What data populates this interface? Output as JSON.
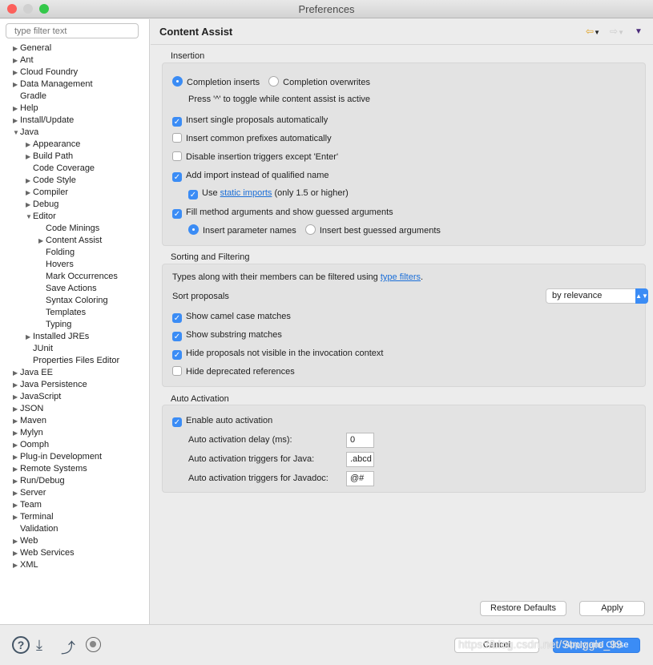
{
  "window": {
    "title": "Preferences"
  },
  "sidebar": {
    "filter_placeholder": "type filter text",
    "items": [
      {
        "label": "General",
        "level": 0,
        "arrow": "right"
      },
      {
        "label": "Ant",
        "level": 0,
        "arrow": "right"
      },
      {
        "label": "Cloud Foundry",
        "level": 0,
        "arrow": "right"
      },
      {
        "label": "Data Management",
        "level": 0,
        "arrow": "right"
      },
      {
        "label": "Gradle",
        "level": 0,
        "arrow": ""
      },
      {
        "label": "Help",
        "level": 0,
        "arrow": "right"
      },
      {
        "label": "Install/Update",
        "level": 0,
        "arrow": "right"
      },
      {
        "label": "Java",
        "level": 0,
        "arrow": "down"
      },
      {
        "label": "Appearance",
        "level": 1,
        "arrow": "right"
      },
      {
        "label": "Build Path",
        "level": 1,
        "arrow": "right"
      },
      {
        "label": "Code Coverage",
        "level": 1,
        "arrow": ""
      },
      {
        "label": "Code Style",
        "level": 1,
        "arrow": "right"
      },
      {
        "label": "Compiler",
        "level": 1,
        "arrow": "right"
      },
      {
        "label": "Debug",
        "level": 1,
        "arrow": "right"
      },
      {
        "label": "Editor",
        "level": 1,
        "arrow": "down"
      },
      {
        "label": "Code Minings",
        "level": 2,
        "arrow": ""
      },
      {
        "label": "Content Assist",
        "level": 2,
        "arrow": "right"
      },
      {
        "label": "Folding",
        "level": 2,
        "arrow": ""
      },
      {
        "label": "Hovers",
        "level": 2,
        "arrow": ""
      },
      {
        "label": "Mark Occurrences",
        "level": 2,
        "arrow": ""
      },
      {
        "label": "Save Actions",
        "level": 2,
        "arrow": ""
      },
      {
        "label": "Syntax Coloring",
        "level": 2,
        "arrow": ""
      },
      {
        "label": "Templates",
        "level": 2,
        "arrow": ""
      },
      {
        "label": "Typing",
        "level": 2,
        "arrow": ""
      },
      {
        "label": "Installed JREs",
        "level": 1,
        "arrow": "right"
      },
      {
        "label": "JUnit",
        "level": 1,
        "arrow": ""
      },
      {
        "label": "Properties Files Editor",
        "level": 1,
        "arrow": ""
      },
      {
        "label": "Java EE",
        "level": 0,
        "arrow": "right"
      },
      {
        "label": "Java Persistence",
        "level": 0,
        "arrow": "right"
      },
      {
        "label": "JavaScript",
        "level": 0,
        "arrow": "right"
      },
      {
        "label": "JSON",
        "level": 0,
        "arrow": "right"
      },
      {
        "label": "Maven",
        "level": 0,
        "arrow": "right"
      },
      {
        "label": "Mylyn",
        "level": 0,
        "arrow": "right"
      },
      {
        "label": "Oomph",
        "level": 0,
        "arrow": "right"
      },
      {
        "label": "Plug-in Development",
        "level": 0,
        "arrow": "right"
      },
      {
        "label": "Remote Systems",
        "level": 0,
        "arrow": "right"
      },
      {
        "label": "Run/Debug",
        "level": 0,
        "arrow": "right"
      },
      {
        "label": "Server",
        "level": 0,
        "arrow": "right"
      },
      {
        "label": "Team",
        "level": 0,
        "arrow": "right"
      },
      {
        "label": "Terminal",
        "level": 0,
        "arrow": "right"
      },
      {
        "label": "Validation",
        "level": 0,
        "arrow": ""
      },
      {
        "label": "Web",
        "level": 0,
        "arrow": "right"
      },
      {
        "label": "Web Services",
        "level": 0,
        "arrow": "right"
      },
      {
        "label": "XML",
        "level": 0,
        "arrow": "right"
      }
    ]
  },
  "page": {
    "title": "Content Assist",
    "insertion": {
      "label": "Insertion",
      "completion_inserts": "Completion inserts",
      "completion_overwrites": "Completion overwrites",
      "toggle_hint": "Press '^' to toggle while content assist is active",
      "single_proposals": "Insert single proposals automatically",
      "common_prefixes": "Insert common prefixes automatically",
      "disable_triggers": "Disable insertion triggers except 'Enter'",
      "add_import": "Add import instead of qualified name",
      "use": "Use",
      "static_imports": "static imports",
      "static_suffix": "(only 1.5 or higher)",
      "fill_args": "Fill method arguments and show guessed arguments",
      "param_names": "Insert parameter names",
      "best_guessed": "Insert best guessed arguments"
    },
    "sorting": {
      "label": "Sorting and Filtering",
      "types_text": "Types along with their members can be filtered using",
      "type_filters": "type filters",
      "period": ".",
      "sort_proposals": "Sort proposals",
      "sort_value": "by relevance",
      "camel_case": "Show camel case matches",
      "substring": "Show substring matches",
      "hide_not_visible": "Hide proposals not visible in the invocation context",
      "hide_deprecated": "Hide deprecated references"
    },
    "auto": {
      "label": "Auto Activation",
      "enable": "Enable auto activation",
      "delay_label": "Auto activation delay (ms):",
      "delay_value": "0",
      "java_label": "Auto activation triggers for Java:",
      "java_value": ".abcd",
      "javadoc_label": "Auto activation triggers for Javadoc:",
      "javadoc_value": "@#"
    },
    "restore_defaults": "Restore Defaults",
    "apply": "Apply"
  },
  "footer": {
    "cancel": "Cancel",
    "apply_close": "Apply and Close"
  },
  "watermark": "https://blog.csdn.net/Struggle_99",
  "colors": {
    "accent": "#3b8cf5",
    "link": "#1a6ed8"
  }
}
